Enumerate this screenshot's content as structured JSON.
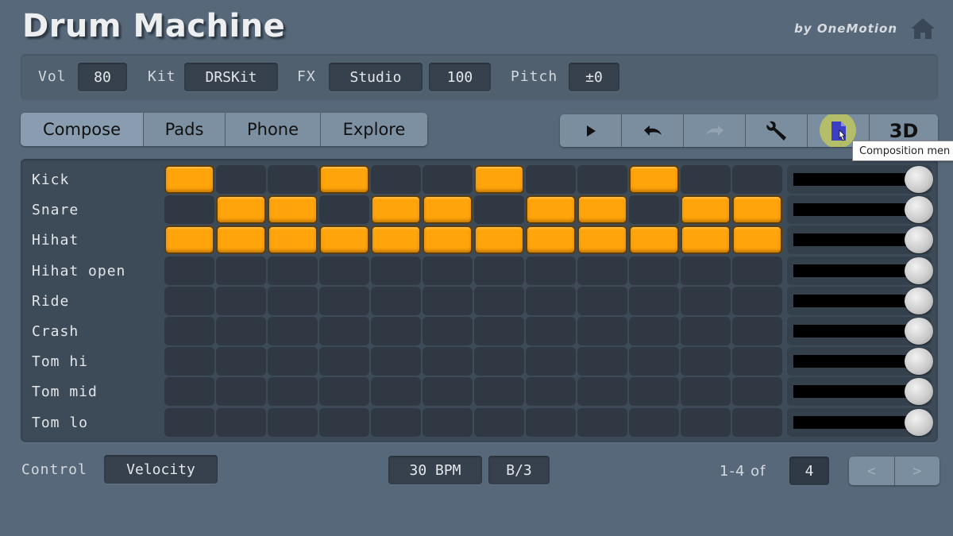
{
  "header": {
    "title": "Drum Machine",
    "byline": "by OneMotion",
    "home_icon": "home-icon"
  },
  "settings": {
    "vol_label": "Vol",
    "vol_value": "80",
    "kit_label": "Kit",
    "kit_value": "DRSKit",
    "fx_label": "FX",
    "fx_value": "Studio",
    "fx_amount": "100",
    "pitch_label": "Pitch",
    "pitch_value": "±0"
  },
  "tabs": [
    {
      "label": "Compose",
      "active": true
    },
    {
      "label": "Pads",
      "active": false
    },
    {
      "label": "Phone",
      "active": false
    },
    {
      "label": "Explore",
      "active": false
    }
  ],
  "toolbar": {
    "buttons": [
      {
        "name": "play-button",
        "icon": "play-icon"
      },
      {
        "name": "undo-button",
        "icon": "undo-icon"
      },
      {
        "name": "redo-button",
        "icon": "redo-icon",
        "disabled": true
      },
      {
        "name": "settings-button",
        "icon": "wrench-icon"
      },
      {
        "name": "composition-menu-button",
        "icon": "document-icon"
      },
      {
        "name": "3d-button",
        "label": "3D"
      }
    ],
    "tooltip": "Composition men"
  },
  "sequencer": {
    "steps": 12,
    "group_size": 3,
    "tracks": [
      {
        "name": "Kick",
        "pattern": [
          1,
          0,
          0,
          1,
          0,
          0,
          1,
          0,
          0,
          1,
          0,
          0
        ],
        "volume": 1.0
      },
      {
        "name": "Snare",
        "pattern": [
          0,
          1,
          1,
          0,
          1,
          1,
          0,
          1,
          1,
          0,
          1,
          1
        ],
        "volume": 1.0
      },
      {
        "name": "Hihat",
        "pattern": [
          1,
          1,
          1,
          1,
          1,
          1,
          1,
          1,
          1,
          1,
          1,
          1
        ],
        "volume": 1.0
      },
      {
        "name": "Hihat open",
        "pattern": [
          0,
          0,
          0,
          0,
          0,
          0,
          0,
          0,
          0,
          0,
          0,
          0
        ],
        "volume": 1.0
      },
      {
        "name": "Ride",
        "pattern": [
          0,
          0,
          0,
          0,
          0,
          0,
          0,
          0,
          0,
          0,
          0,
          0
        ],
        "volume": 1.0
      },
      {
        "name": "Crash",
        "pattern": [
          0,
          0,
          0,
          0,
          0,
          0,
          0,
          0,
          0,
          0,
          0,
          0
        ],
        "volume": 1.0
      },
      {
        "name": "Tom hi",
        "pattern": [
          0,
          0,
          0,
          0,
          0,
          0,
          0,
          0,
          0,
          0,
          0,
          0
        ],
        "volume": 1.0
      },
      {
        "name": "Tom mid",
        "pattern": [
          0,
          0,
          0,
          0,
          0,
          0,
          0,
          0,
          0,
          0,
          0,
          0
        ],
        "volume": 1.0
      },
      {
        "name": "Tom lo",
        "pattern": [
          0,
          0,
          0,
          0,
          0,
          0,
          0,
          0,
          0,
          0,
          0,
          0
        ],
        "volume": 1.0
      }
    ]
  },
  "footer": {
    "control_label": "Control",
    "control_value": "Velocity",
    "bpm": "30 BPM",
    "signature": "B/3",
    "page_range": "1-4 of",
    "page_total": "4",
    "prev_label": "<",
    "next_label": ">"
  },
  "colors": {
    "step_on": "#ffa40a",
    "step_off": "#2f3843",
    "background": "#566879"
  }
}
